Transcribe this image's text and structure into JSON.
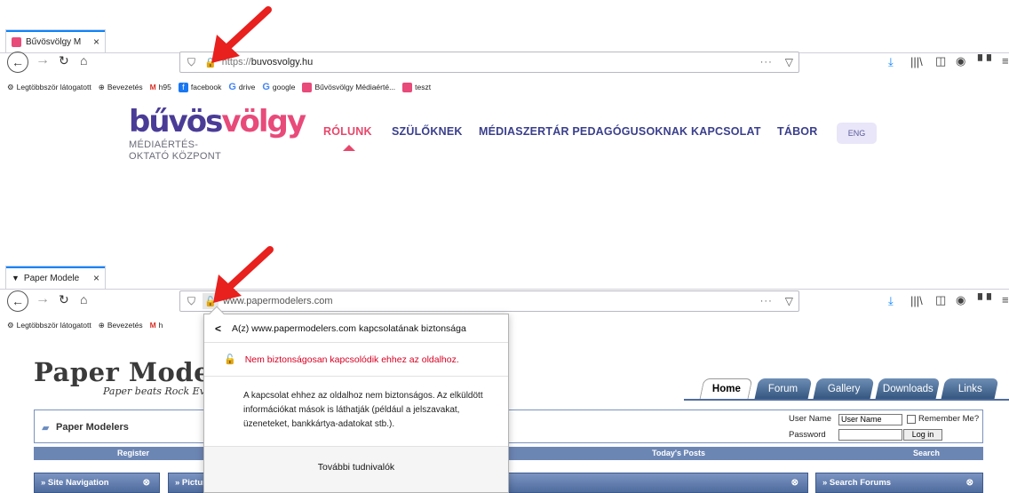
{
  "top_browser": {
    "tab_title": "Bűvösvölgy M",
    "tab_close": "×",
    "url_scheme": "https://",
    "url_host": "buvosvolgy.hu",
    "url_more": "···"
  },
  "bookmarks_top": [
    {
      "label": "Legtöbbször látogatott",
      "icon": "gear-icon"
    },
    {
      "label": "Bevezetés",
      "icon": "globe-icon"
    },
    {
      "label": "h95",
      "icon": "gmail-icon"
    },
    {
      "label": "facebook",
      "icon": "facebook-icon"
    },
    {
      "label": "drive",
      "icon": "google-icon"
    },
    {
      "label": "google",
      "icon": "google-icon"
    },
    {
      "label": "Bűvösvölgy Médiaérté...",
      "icon": "buvosvolgy-icon"
    },
    {
      "label": "teszt",
      "icon": "buvosvolgy-icon"
    }
  ],
  "site1": {
    "logo_part1": "bűvös",
    "logo_part2": "völgy",
    "logo_sub_line1": "MÉDIAÉRTÉS-",
    "logo_sub_line2": "OKTATÓ KÖZPONT",
    "nav": [
      "RÓLUNK",
      "SZÜLŐKNEK",
      "MÉDIASZERTÁR PEDAGÓGUSOKNAK",
      "KAPCSOLAT",
      "TÁBOR"
    ],
    "lang_button": "ENG"
  },
  "bottom_browser": {
    "tab_title": "Paper Modele",
    "tab_close": "×",
    "url": "www.papermodelers.com",
    "url_more": "···"
  },
  "bookmarks_bottom": [
    {
      "label": "Legtöbbször látogatott"
    },
    {
      "label": "Bevezetés"
    },
    {
      "label": "h"
    }
  ],
  "site2": {
    "title": "Paper Modele",
    "slogan": "Paper beats Rock Eve",
    "tabs": [
      "Home",
      "Forum",
      "Gallery",
      "Downloads",
      "Links"
    ],
    "header_name": "Paper Modelers",
    "login": {
      "user_label": "User Name",
      "user_value": "User Name",
      "password_label": "Password",
      "remember": "Remember Me?",
      "login_button": "Log in"
    },
    "bar": [
      "Register",
      "Today's Posts",
      "Search"
    ],
    "boxes": [
      "» Site Navigation",
      "» Picture of the week",
      "» Search Forums"
    ]
  },
  "popup": {
    "back": "<",
    "header": "A(z) www.papermodelers.com kapcsolatának biztonsága",
    "warning": "Nem biztonságosan kapcsolódik ehhez az oldalhoz.",
    "desc": "A kapcsolat ehhez az oldalhoz nem biztonságos. Az elküldött információkat mások is láthatják (például a jelszavakat, üzeneteket, bankkártya-adatokat stb.).",
    "more": "További tudnivalók"
  },
  "colors": {
    "arrow": "#e8201e",
    "brand_purple": "#4a3c96",
    "brand_pink": "#e84a7a",
    "warning_red": "#d70022",
    "firefox_accent": "#0a84ff"
  }
}
